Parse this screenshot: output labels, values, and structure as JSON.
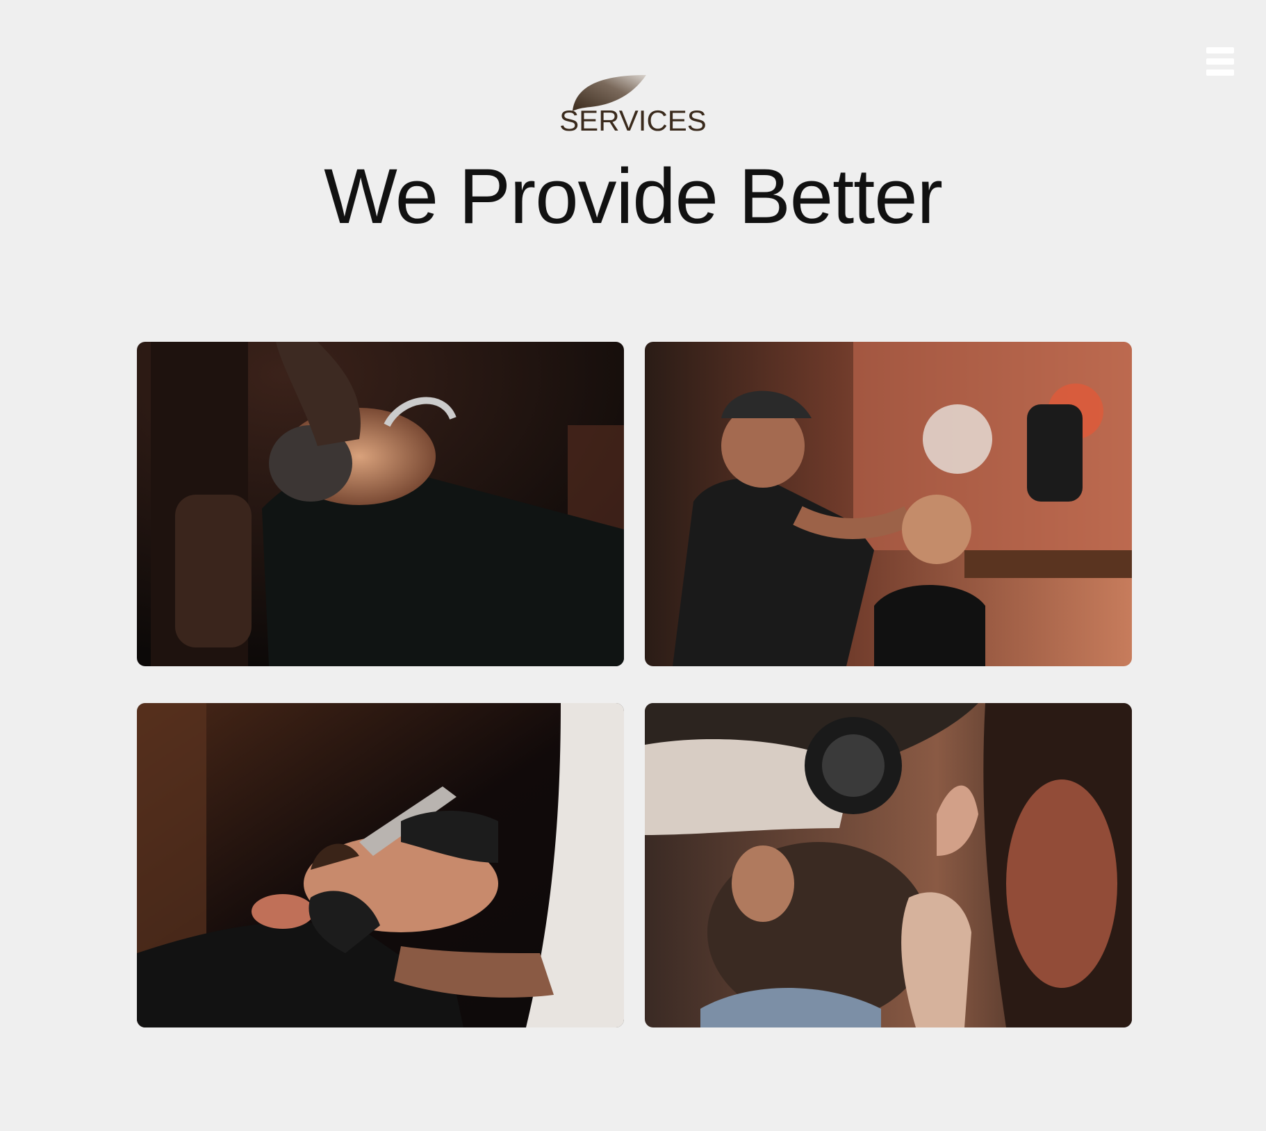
{
  "nav": {
    "menu_icon": "hamburger-menu-icon"
  },
  "section": {
    "eyebrow": "SERVICES",
    "eyebrow_icon": "leaf-icon",
    "headline": "We Provide Better"
  },
  "gallery": {
    "photos": [
      {
        "subject": "barber trimming beard with scissors"
      },
      {
        "subject": "barber cutting client hair in graffiti shop"
      },
      {
        "subject": "barber shaving customer with clippers"
      },
      {
        "subject": "barber trimming side of client's head"
      }
    ]
  },
  "colors": {
    "background": "#efefef",
    "eyebrow_text": "#3a2a1c",
    "headline_text": "#111111",
    "menu_icon": "#ffffff"
  }
}
